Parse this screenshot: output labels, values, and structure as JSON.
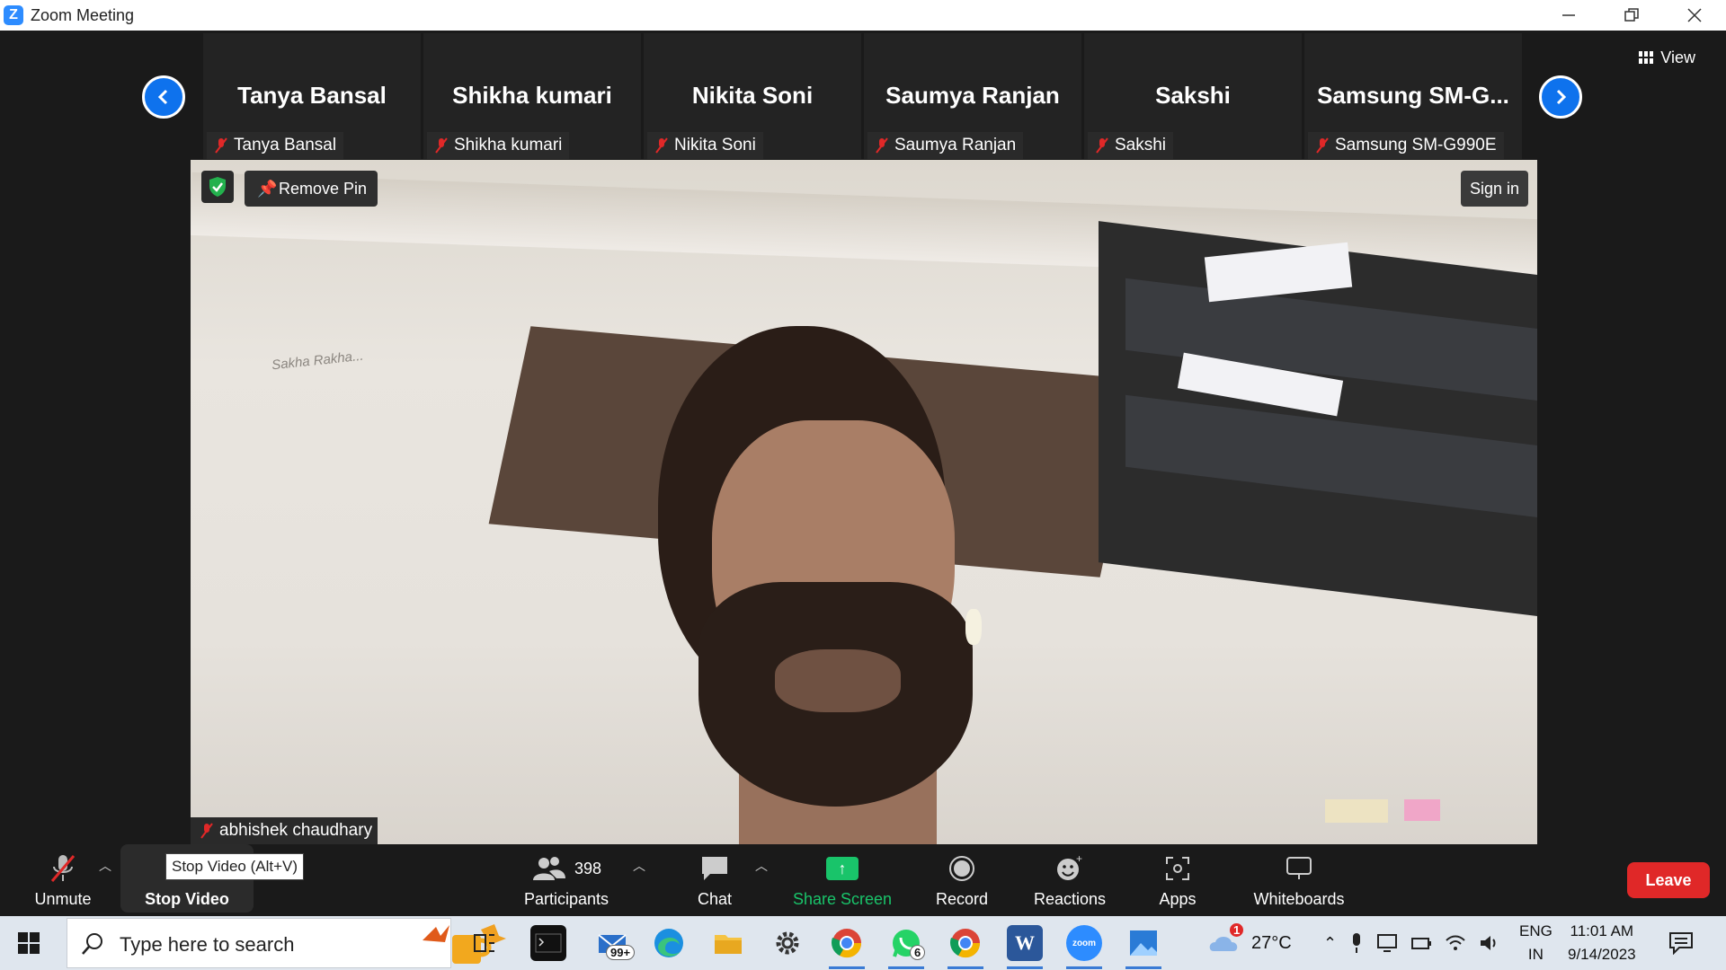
{
  "window": {
    "title": "Zoom Meeting",
    "app_logo": "Z"
  },
  "strip": {
    "participants": [
      {
        "display_name": "Tanya Bansal",
        "label": "Tanya Bansal"
      },
      {
        "display_name": "Shikha kumari",
        "label": "Shikha kumari"
      },
      {
        "display_name": "Nikita Soni",
        "label": "Nikita Soni"
      },
      {
        "display_name": "Saumya Ranjan",
        "label": "Saumya Ranjan"
      },
      {
        "display_name": "Sakshi",
        "label": "Sakshi"
      },
      {
        "display_name": "Samsung  SM-G...",
        "label": "Samsung SM-G990E"
      }
    ],
    "prev_icon": "chevron-left-icon",
    "next_icon": "chevron-right-icon"
  },
  "view_button": {
    "label": "View"
  },
  "main_video": {
    "remove_pin_label": "Remove Pin",
    "sign_in_label": "Sign in",
    "self_name": "abhishek chaudhary",
    "wall_scribble": "Sakha Rakha..."
  },
  "toolbar": {
    "unmute": "Unmute",
    "stop_video": "Stop Video",
    "stop_video_tooltip": "Stop Video (Alt+V)",
    "participants": "Participants",
    "participants_count": "398",
    "chat": "Chat",
    "share_screen": "Share Screen",
    "record": "Record",
    "reactions": "Reactions",
    "apps": "Apps",
    "whiteboards": "Whiteboards",
    "leave": "Leave"
  },
  "taskbar": {
    "search_placeholder": "Type here to search",
    "mail_badge": "99+",
    "whatsapp_badge": "6",
    "weather_badge": "1",
    "temperature": "27°C",
    "lang_top": "ENG",
    "lang_bottom": "IN",
    "time": "11:01 AM",
    "date": "9/14/2023",
    "zoom_icon_text": "zoom",
    "word_icon_text": "W"
  },
  "colors": {
    "accent_blue": "#0e72ed",
    "leave_red": "#e02828",
    "share_green": "#19c46a",
    "mute_red": "#e02828"
  }
}
